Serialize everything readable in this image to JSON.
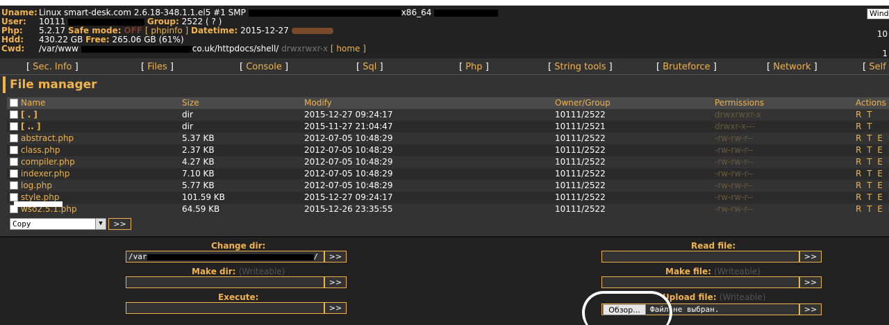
{
  "header": {
    "uname_label": "Uname:",
    "uname_value": "Linux smart-desk.com 2.6.18-348.1.1.el5 #1 SMP",
    "uname_tail": "x86_64",
    "user_label": "User:",
    "user_value": "10111",
    "group_label": "Group:",
    "group_value": "2522 ( ? )",
    "php_label": "Php:",
    "php_value": "5.2.17",
    "safe_mode_label": "Safe mode:",
    "safe_mode_value": "OFF",
    "phpinfo_link": "[ phpinfo ]",
    "datetime_label": "Datetime:",
    "datetime_value": "2015-12-27",
    "hdd_label": "Hdd:",
    "hdd_value": "430.22 GB",
    "free_label": "Free:",
    "free_value": "265.06 GB (61%)",
    "cwd_label": "Cwd:",
    "cwd_value_start": "/var/www",
    "cwd_value_end": "co.uk/httpdocs/shell/",
    "cwd_perms": "drwxrwxr-x",
    "home_link": "[ home ]",
    "win_button": "Wind",
    "right_fragment_1": "10",
    "right_fragment_2": "1"
  },
  "menu": {
    "items": [
      {
        "label": "Sec. Info"
      },
      {
        "label": "Files"
      },
      {
        "label": "Console"
      },
      {
        "label": "Sql"
      },
      {
        "label": "Php"
      },
      {
        "label": "String tools"
      },
      {
        "label": "Bruteforce"
      },
      {
        "label": "Network"
      },
      {
        "label": "Self"
      }
    ]
  },
  "file_manager": {
    "title": "File manager",
    "columns": [
      "Name",
      "Size",
      "Modify",
      "Owner/Group",
      "Permissions",
      "Actions"
    ],
    "rows": [
      {
        "name": "[ . ]",
        "size": "dir",
        "modify": "2015-12-27 09:24:17",
        "owner": "10111/2522",
        "perms": "drwxrwxr-x",
        "actions": "R T",
        "is_dir": true
      },
      {
        "name": "[ .. ]",
        "size": "dir",
        "modify": "2015-11-27 21:04:47",
        "owner": "10111/2521",
        "perms": "drwxr-x---",
        "actions": "R T",
        "is_dir": true
      },
      {
        "name": "abstract.php",
        "size": "5.37 KB",
        "modify": "2012-07-05 10:48:29",
        "owner": "10111/2522",
        "perms": "-rw-rw-r--",
        "actions": "R T E D",
        "is_dir": false
      },
      {
        "name": "class.php",
        "size": "2.37 KB",
        "modify": "2012-07-05 10:48:29",
        "owner": "10111/2522",
        "perms": "-rw-rw-r--",
        "actions": "R T E D",
        "is_dir": false
      },
      {
        "name": "compiler.php",
        "size": "4.27 KB",
        "modify": "2012-07-05 10:48:29",
        "owner": "10111/2522",
        "perms": "-rw-rw-r--",
        "actions": "R T E D",
        "is_dir": false
      },
      {
        "name": "indexer.php",
        "size": "7.10 KB",
        "modify": "2012-07-05 10:48:29",
        "owner": "10111/2522",
        "perms": "-rw-rw-r--",
        "actions": "R T E D",
        "is_dir": false
      },
      {
        "name": "log.php",
        "size": "5.77 KB",
        "modify": "2012-07-05 10:48:29",
        "owner": "10111/2522",
        "perms": "-rw-rw-r--",
        "actions": "R T E D",
        "is_dir": false
      },
      {
        "name": "style.php",
        "size": "101.59 KB",
        "modify": "2015-12-27 09:24:17",
        "owner": "10111/2522",
        "perms": "-rw-rw-r--",
        "actions": "R T E D",
        "is_dir": false
      },
      {
        "name": "wso2.5.1.php",
        "size": "64.59 KB",
        "modify": "2015-12-26 23:35:55",
        "owner": "10111/2522",
        "perms": "-rw-rw-r--",
        "actions": "R T E D",
        "is_dir": false
      }
    ],
    "action_select": "Copy",
    "go_label": ">>"
  },
  "forms": {
    "change_dir_label": "Change dir:",
    "change_dir_value": "/var",
    "change_dir_tail": "/",
    "make_dir_label": "Make dir:",
    "make_dir_writeable": "(Writeable)",
    "execute_label": "Execute:",
    "read_file_label": "Read file:",
    "make_file_label": "Make file:",
    "make_file_writeable": "(Writeable)",
    "upload_file_label": "Upload file:",
    "upload_file_writeable": "(Writeable)",
    "browse_button": "Обзор...",
    "no_file_text": "Файл не выбран.",
    "submit_label": ">>"
  },
  "colors": {
    "accent": "#f1b34a",
    "background": "#333333",
    "header_bg": "#222222"
  }
}
